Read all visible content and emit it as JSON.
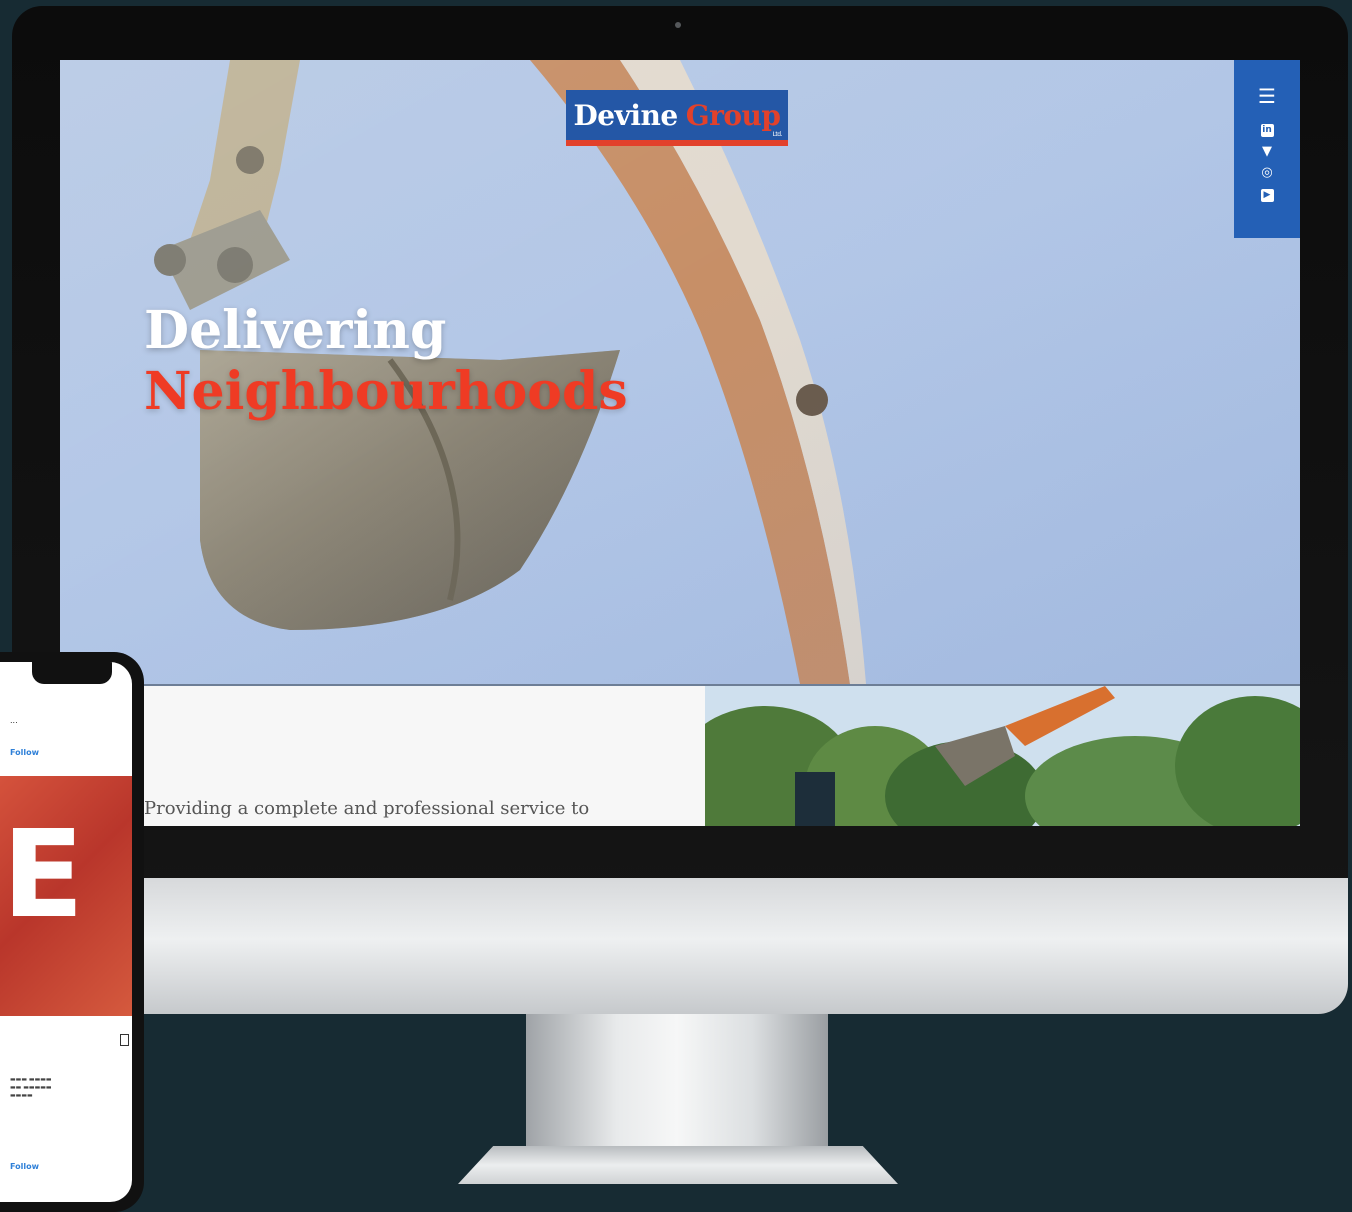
{
  "site": {
    "logo": {
      "word1": "Devine",
      "word2": "Group",
      "tagline": "Ltd."
    },
    "hero": {
      "headline_line1": "Delivering",
      "headline_line2": "Neighbourhoods"
    },
    "intro_text": "Providing a complete and professional service to",
    "sidebar_icons": [
      "menu-icon",
      "linkedin-icon",
      "twitter-icon",
      "issuu-icon",
      "youtube-icon"
    ]
  },
  "phone": {
    "header_label": "...",
    "follow_label": "Follow",
    "second_follow_label": "Follow"
  },
  "colors": {
    "background": "#172b33",
    "brand_blue": "#2460b6",
    "brand_red": "#e2412b"
  }
}
